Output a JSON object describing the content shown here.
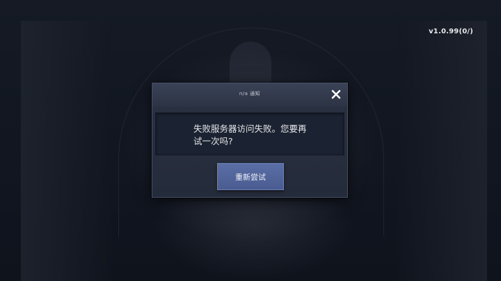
{
  "version": "v1.0.99(0/)",
  "dialog": {
    "title": "n/a 通知",
    "message": "失败服务器访问失败。您要再试一次吗?",
    "retry_label": "重新尝试",
    "close_icon": "close-icon"
  },
  "colors": {
    "dialog_bg": "#262d3c",
    "button_bg": "#5264a0",
    "text": "#e6e7ea"
  }
}
